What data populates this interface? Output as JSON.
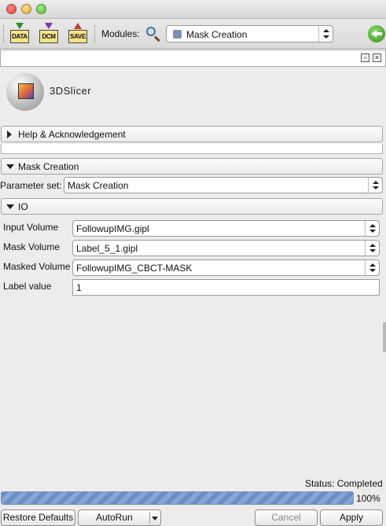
{
  "toolbar": {
    "data_label": "DATA",
    "dcm_label": "DCM",
    "save_label": "SAVE",
    "modules_label": "Modules:",
    "module_selected": "Mask Creation"
  },
  "logo": {
    "text": "3DSlicer"
  },
  "sections": {
    "help": "Help & Acknowledgement",
    "mask_creation": "Mask Creation",
    "io": "IO"
  },
  "parameter_set": {
    "label": "Parameter set:",
    "value": "Mask Creation"
  },
  "io_fields": {
    "input_volume": {
      "label": "Input Volume",
      "value": "FollowupIMG.gipl"
    },
    "mask_volume": {
      "label": "Mask Volume",
      "value": "Label_5_1.gipl"
    },
    "masked_volume": {
      "label": "Masked Volume",
      "value": "FollowupIMG_CBCT-MASK"
    },
    "label_value": {
      "label": "Label value",
      "value": "1"
    }
  },
  "status": {
    "text": "Status: Completed",
    "progress_percent": 100,
    "progress_label": "100%"
  },
  "buttons": {
    "restore_defaults": "Restore Defaults",
    "autorun": "AutoRun",
    "cancel": "Cancel",
    "apply": "Apply"
  },
  "colors": {
    "progress_fill": "#6c8fc4",
    "accent_green": "#2e8b1e"
  }
}
